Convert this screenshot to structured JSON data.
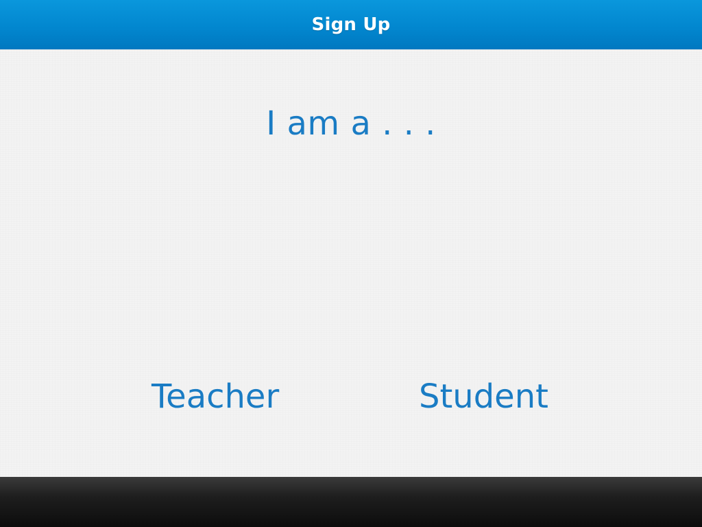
{
  "header": {
    "title": "Sign Up"
  },
  "main": {
    "prompt": "I am a . . .",
    "choices": [
      {
        "label": "Teacher"
      },
      {
        "label": "Student"
      }
    ]
  },
  "colors": {
    "header_blue": "#0287cf",
    "accent_text": "#1a7cc4",
    "footer": "#1e1e1e",
    "background": "#f3f3f3"
  }
}
